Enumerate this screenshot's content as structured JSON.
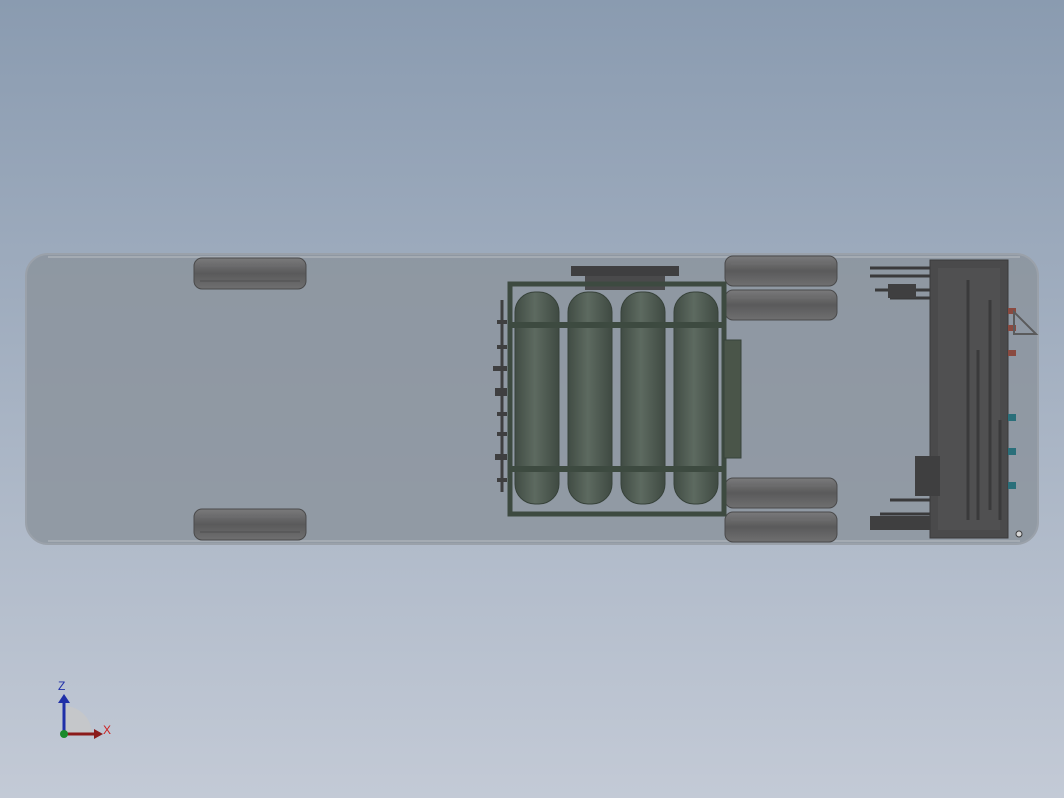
{
  "viewport": {
    "background_top": "#8a9bb0",
    "background_bottom": "#c3cad6"
  },
  "model": {
    "body_fill": "#8c949e",
    "body_edge": "#9aa1aa",
    "tire_color": "#5e5e5f",
    "tank_color": "#4f5b52",
    "tank_frame_color": "#3d4a40",
    "tank_count": 4,
    "equipment_color": "#3f3f40"
  },
  "triad": {
    "x_label": "X",
    "z_label": "Z",
    "x_color": "#cc1f1f",
    "z_color": "#1f2fa8",
    "y_color": "#1a8a2a"
  }
}
